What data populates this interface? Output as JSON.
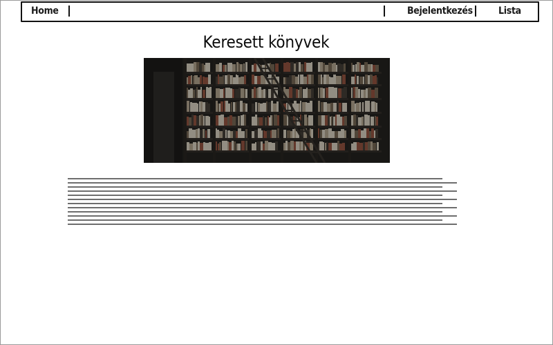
{
  "nav": {
    "home_label": "Home",
    "login_label": "Bejelentkezés",
    "list_label": "Lista"
  },
  "page": {
    "title": "Keresett könyvek"
  },
  "hero": {
    "image_name": "library-bookshelves-photo"
  },
  "colors": {
    "border": "#111111",
    "background": "#ffffff",
    "line": "#6d6d6d"
  }
}
